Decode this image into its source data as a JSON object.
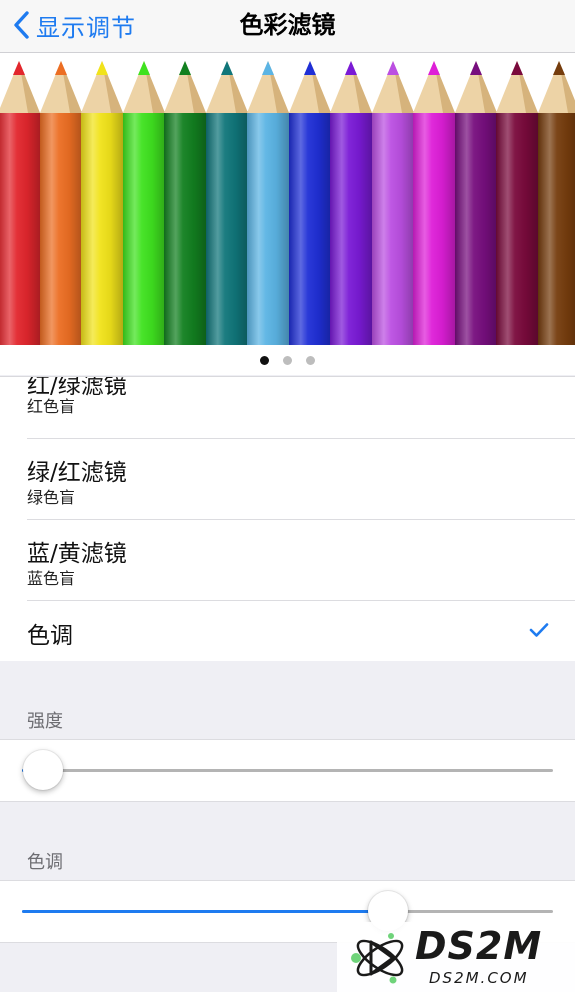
{
  "nav": {
    "back_label": "显示调节",
    "title": "色彩滤镜"
  },
  "carousel": {
    "pencil_colors": [
      "#e2262d",
      "#ec6e23",
      "#f1e31a",
      "#3fe21f",
      "#128020",
      "#10767a",
      "#5bb4e4",
      "#1f2fd6",
      "#7a1ad6",
      "#bb4fe2",
      "#de1ed8",
      "#770e7e",
      "#7a0a3c",
      "#753c0d"
    ],
    "page_count": 3,
    "active_page": 0
  },
  "filters": [
    {
      "title": "红/绿滤镜",
      "subtitle": "红色盲"
    },
    {
      "title": "绿/红滤镜",
      "subtitle": "绿色盲"
    },
    {
      "title": "蓝/黄滤镜",
      "subtitle": "蓝色盲"
    },
    {
      "title": "色调",
      "subtitle": "",
      "checked": true
    }
  ],
  "intensity": {
    "label": "强度",
    "value": 0.04
  },
  "hue": {
    "label": "色调",
    "value": 0.69
  },
  "colors": {
    "accent": "#1e7bf0",
    "background": "#efeff4"
  },
  "watermark": {
    "main": "DS2M",
    "sub": "DS2M.COM"
  }
}
